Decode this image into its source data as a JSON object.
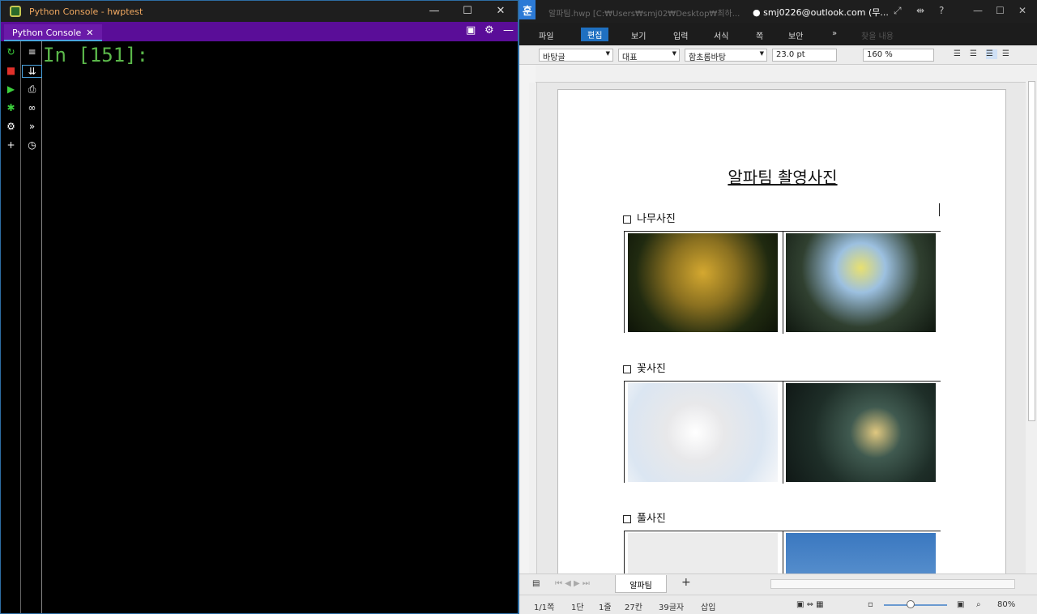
{
  "pycharm": {
    "title": "Python Console - hwptest",
    "tab_label": "Python Console",
    "tab_close": "✕",
    "prompt": "In [151]:"
  },
  "hwp": {
    "logo": "훈",
    "title_path": "알파팀.hwp [C:₩Users₩smj02₩Desktop₩최하...",
    "account": "smj0226@outlook.com (무...",
    "menu": [
      "파일",
      "편집",
      "보기",
      "입력",
      "서식",
      "쪽",
      "보안"
    ],
    "search_placeholder": "찾을 내용",
    "style_box": "바탕글",
    "font_lang": "대표",
    "font_name": "함초롬바탕",
    "font_size": "23.0",
    "font_unit": "pt",
    "zoom_box": "160",
    "zoom_unit": "%",
    "doc_title": "알파팀 촬영사진",
    "sections": [
      "나무사진",
      "꽃사진",
      "풀사진"
    ],
    "sheet_tab": "알파팀",
    "status": [
      "1/1쪽",
      "1단",
      "1줄",
      "27칸",
      "39글자",
      "삽입"
    ],
    "zoom_percent": "80%"
  }
}
